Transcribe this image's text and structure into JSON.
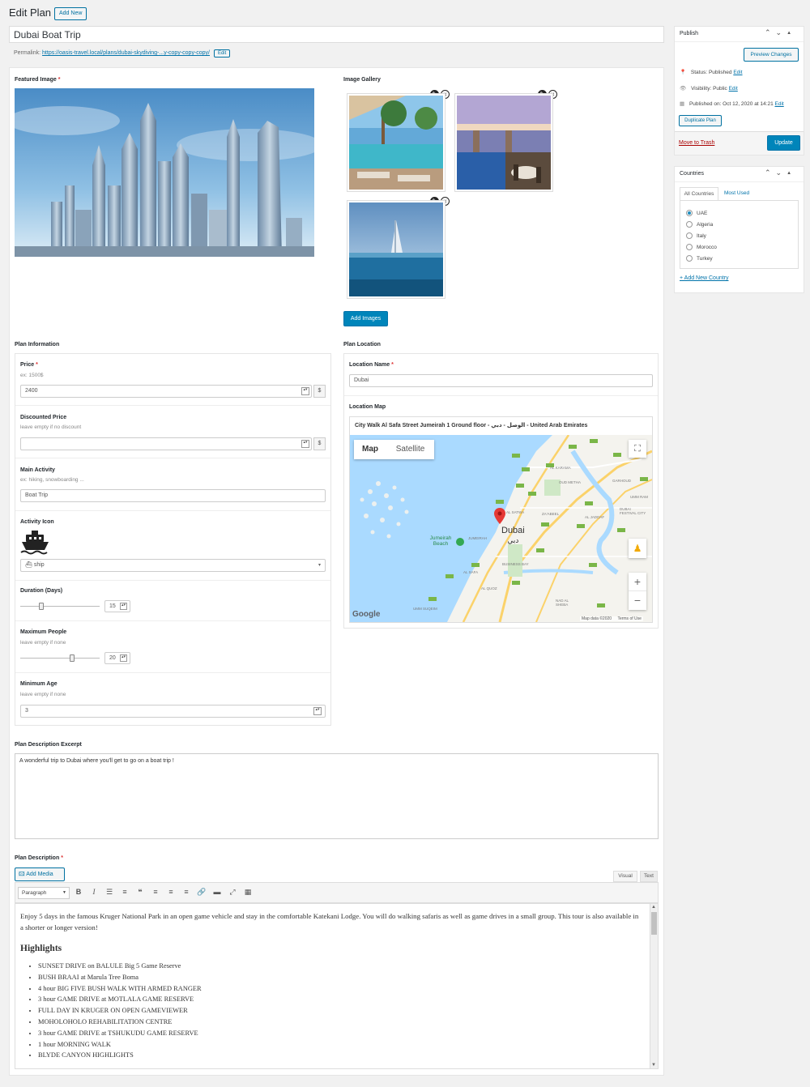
{
  "header": {
    "title": "Edit Plan",
    "add_new": "Add New",
    "plan_title": "Dubai Boat Trip",
    "permalink_label": "Permalink:",
    "permalink_url": "https://oasis-travel.local/plans/dubai-skydiving-...y-copy-copy-copy/",
    "permalink_edit": "Edit"
  },
  "featured_image": {
    "label": "Featured Image",
    "required_mark": "*"
  },
  "gallery": {
    "label": "Image Gallery",
    "add_button": "Add Images",
    "images": [
      "resort-pool",
      "restaurant-pool",
      "burj-al-arab"
    ]
  },
  "plan_info": {
    "section_label": "Plan Information",
    "price": {
      "label": "Price",
      "hint": "ex: 1500$",
      "value": "2400",
      "addon": "$"
    },
    "discounted_price": {
      "label": "Discounted Price",
      "hint": "leave empty if no discount",
      "value": "",
      "addon": "$"
    },
    "main_activity": {
      "label": "Main Activity",
      "hint": "ex: hiking, snowboarding ...",
      "value": "Boat Trip"
    },
    "activity_icon": {
      "label": "Activity Icon",
      "selected": "ship",
      "icon": "ship-icon"
    },
    "duration": {
      "label": "Duration (Days)",
      "value": "15",
      "slider_fraction": 0.27
    },
    "max_people": {
      "label": "Maximum People",
      "hint": "leave empty if none",
      "value": "20",
      "slider_fraction": 0.65
    },
    "min_age": {
      "label": "Minimum Age",
      "hint": "leave empty if none",
      "value": "3"
    }
  },
  "plan_location": {
    "section_label": "Plan Location",
    "location_name_label": "Location Name",
    "location_name_value": "Dubai",
    "location_map_label": "Location Map",
    "address": "City Walk Al Safa Street Jumeirah 1 Ground floor - الوصل - دبي - United Arab Emirates",
    "map_tab": "Map",
    "satellite_tab": "Satellite",
    "city_label": "Dubai",
    "city_label_ar": "دبي",
    "beach_label": "Jumeirah Beach",
    "areas": [
      "AL KARAMA",
      "OUD METHA",
      "GARHOUD",
      "AL SATWA",
      "ZA'ABEEL",
      "AL JADDAF",
      "DUBAI FESTIVAL CITY",
      "JUMEIRAH",
      "BUSINESS BAY",
      "AL SAFA",
      "AL QUOZ",
      "NAD AL SHEBA",
      "UMM SUQEIM",
      "UMM RAMOOL"
    ],
    "google": "Google",
    "map_data": "Map data ©2020",
    "terms": "Terms of Use",
    "zoom_in": "+",
    "zoom_out": "−"
  },
  "excerpt": {
    "label": "Plan Description Excerpt",
    "value": "A wonderful trip to Dubai where you'll get to go on a boat trip !"
  },
  "description": {
    "label": "Plan Description",
    "add_media": "Add Media",
    "visual_tab": "Visual",
    "text_tab": "Text",
    "format_select": "Paragraph",
    "paragraph": "Enjoy 5 days in the famous Kruger National Park in an open game vehicle and stay in the comfortable Katekani Lodge. You will do walking safaris as well as game drives in a small group. This tour is also available in a shorter or longer version!",
    "heading": "Highlights",
    "items": [
      "SUNSET DRIVE on BALULE Big 5 Game Reserve",
      "BUSH BRAAI at Marula Tree Boma",
      "4 hour BIG FIVE BUSH WALK WITH ARMED RANGER",
      "3 hour GAME DRIVE at MOTLALA GAME RESERVE",
      "FULL DAY IN KRUGER ON OPEN GAMEVIEWER",
      "MOHOLOHOLO REHABILITATION CENTRE",
      "3 hour GAME DRIVE at TSHUKUDU GAME RESERVE",
      "1 hour MORNING WALK",
      "BLYDE CANYON HIGHLIGHTS"
    ]
  },
  "publish": {
    "title": "Publish",
    "preview": "Preview Changes",
    "status_label": "Status:",
    "status_value": "Published",
    "visibility_label": "Visibility:",
    "visibility_value": "Public",
    "published_label": "Published on:",
    "published_value": "Oct 12, 2020 at 14:21",
    "edit": "Edit",
    "duplicate": "Duplicate Plan",
    "trash": "Move to Trash",
    "update": "Update"
  },
  "countries": {
    "title": "Countries",
    "tab_all": "All Countries",
    "tab_most_used": "Most Used",
    "items": [
      {
        "name": "UAE",
        "checked": true
      },
      {
        "name": "Algeria",
        "checked": false
      },
      {
        "name": "Italy",
        "checked": false
      },
      {
        "name": "Morocco",
        "checked": false
      },
      {
        "name": "Turkey",
        "checked": false
      }
    ],
    "add_new": "+ Add New Country"
  },
  "colors": {
    "accent": "#0085ba",
    "link": "#0073aa",
    "required": "#dc3232",
    "map_water": "#aadaff",
    "map_land": "#f4f3ee"
  }
}
